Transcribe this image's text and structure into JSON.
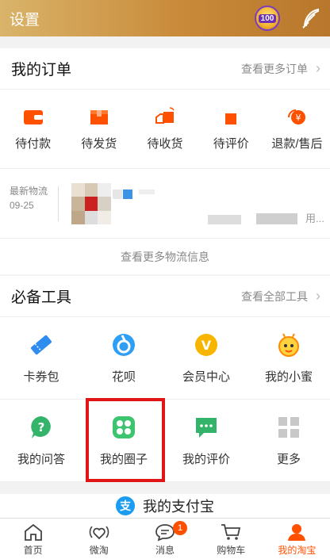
{
  "header": {
    "title": "设置",
    "points_badge": "100",
    "settings_icon": "feather-brush-icon"
  },
  "orders": {
    "title": "我的订单",
    "more_label": "查看更多订单",
    "items": [
      {
        "label": "待付款",
        "icon": "wallet-icon"
      },
      {
        "label": "待发货",
        "icon": "box-icon"
      },
      {
        "label": "待收货",
        "icon": "truck-icon"
      },
      {
        "label": "待评价",
        "icon": "comment-icon"
      },
      {
        "label": "退款/售后",
        "icon": "refund-icon"
      }
    ],
    "logistics": {
      "label": "最新物流",
      "date": "09-25",
      "tail_text": "用...",
      "more_label": "查看更多物流信息"
    }
  },
  "tools": {
    "title": "必备工具",
    "more_label": "查看全部工具",
    "items": [
      {
        "label": "卡券包",
        "icon": "ticket-icon"
      },
      {
        "label": "花呗",
        "icon": "huabei-icon"
      },
      {
        "label": "会员中心",
        "icon": "vip-icon"
      },
      {
        "label": "我的小蜜",
        "icon": "bee-icon"
      },
      {
        "label": "我的问答",
        "icon": "question-icon"
      },
      {
        "label": "我的圈子",
        "icon": "circle-group-icon"
      },
      {
        "label": "我的评价",
        "icon": "review-chat-icon"
      },
      {
        "label": "更多",
        "icon": "grid-more-icon"
      }
    ],
    "highlighted": "我的圈子"
  },
  "alipay": {
    "logo": "支",
    "title": "我的支付宝"
  },
  "tabbar": {
    "items": [
      {
        "label": "首页",
        "icon": "home-icon"
      },
      {
        "label": "微淘",
        "icon": "heart-signal-icon"
      },
      {
        "label": "消息",
        "icon": "message-icon",
        "badge": "1"
      },
      {
        "label": "购物车",
        "icon": "cart-icon"
      },
      {
        "label": "我的淘宝",
        "icon": "user-icon"
      }
    ],
    "active": "我的淘宝"
  },
  "colors": {
    "accent": "#ff5000",
    "order_icon": "#ff5000",
    "highlight": "#e01616",
    "header_gradient": [
      "#d9b46a",
      "#b8772c"
    ]
  }
}
